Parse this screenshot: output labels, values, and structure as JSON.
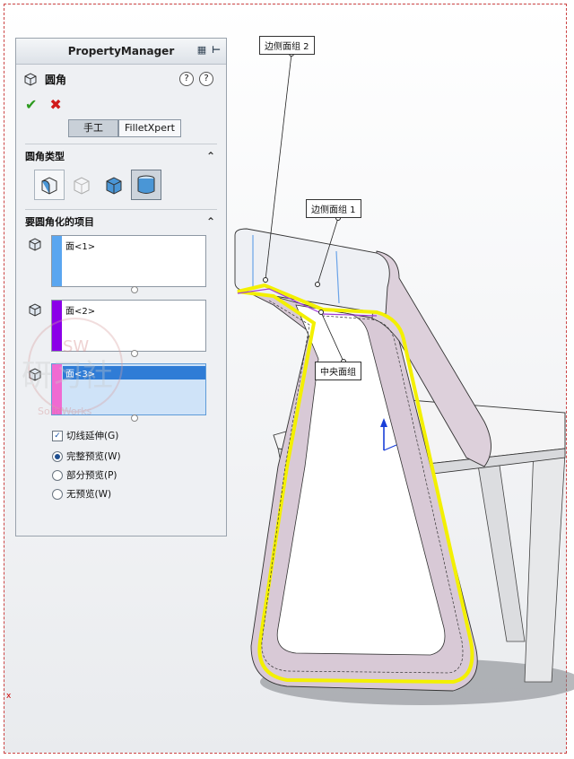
{
  "panel": {
    "title": "PropertyManager",
    "feature_title": "圆角",
    "help_label": "?",
    "mode_manual": "手工",
    "mode_expert": "FilletXpert"
  },
  "fillet_type": {
    "title": "圆角类型",
    "selected_index": 3
  },
  "items": {
    "title": "要圆角化的项目",
    "faces": [
      {
        "label": "面<1>",
        "color": "#5aa6f0"
      },
      {
        "label": "面<2>",
        "color": "#8b00e8"
      },
      {
        "label": "面<3>",
        "color": "#f06ad2",
        "selected": true
      }
    ]
  },
  "options": {
    "tangent": {
      "label": "切线延伸(G)",
      "checked": true
    },
    "full_preview": {
      "label": "完整预览(W)",
      "selected": true
    },
    "partial_preview": {
      "label": "部分预览(P)",
      "selected": false
    },
    "no_preview": {
      "label": "无预览(W)",
      "selected": false
    }
  },
  "callouts": {
    "side_face_2": "边侧面组 2",
    "side_face_1": "边侧面组 1",
    "center_face": "中央面组"
  },
  "watermark": {
    "top": "SW",
    "main": "研习社",
    "brand": "SolidWorks"
  },
  "colors": {
    "highlight": "#f3f000",
    "chair": "#d9cbd6",
    "selection": "#2f7cd6"
  },
  "icons": [
    "pin-icon",
    "fillet-feature-icon",
    "help-icon",
    "ok-icon",
    "cancel-icon",
    "face-icon",
    "chevron-up-icon"
  ]
}
